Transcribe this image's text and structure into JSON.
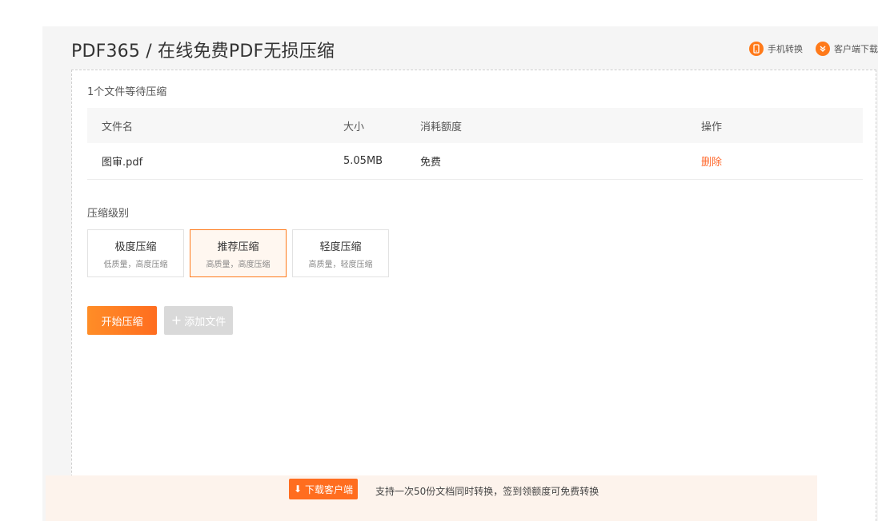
{
  "header": {
    "title": "PDF365 / 在线免费PDF无损压缩",
    "links": [
      {
        "label": "手机转换",
        "icon": "phone-icon"
      },
      {
        "label": "客户端下载",
        "icon": "download-client-icon"
      }
    ]
  },
  "files": {
    "waiting_text": "1个文件等待压缩",
    "columns": [
      "文件名",
      "大小",
      "消耗额度",
      "操作"
    ],
    "rows": [
      {
        "name": "图审.pdf",
        "size": "5.05MB",
        "quota": "免费",
        "action": "删除"
      }
    ]
  },
  "compression": {
    "label": "压缩级别",
    "levels": [
      {
        "title": "极度压缩",
        "subtitle": "低质量，高度压缩",
        "selected": false
      },
      {
        "title": "推荐压缩",
        "subtitle": "高质量，高度压缩",
        "selected": true
      },
      {
        "title": "轻度压缩",
        "subtitle": "高质量，轻度压缩",
        "selected": false
      }
    ]
  },
  "actions": {
    "start_label": "开始压缩",
    "add_label": "添加文件"
  },
  "promo": {
    "download_button": "下载客户端",
    "text": "支持一次50份文档同时转换，签到领额度可免费转换"
  },
  "colors": {
    "accent": "#ff7a1a",
    "delete": "#ff6a2e",
    "disabled": "#d9d9d9"
  }
}
